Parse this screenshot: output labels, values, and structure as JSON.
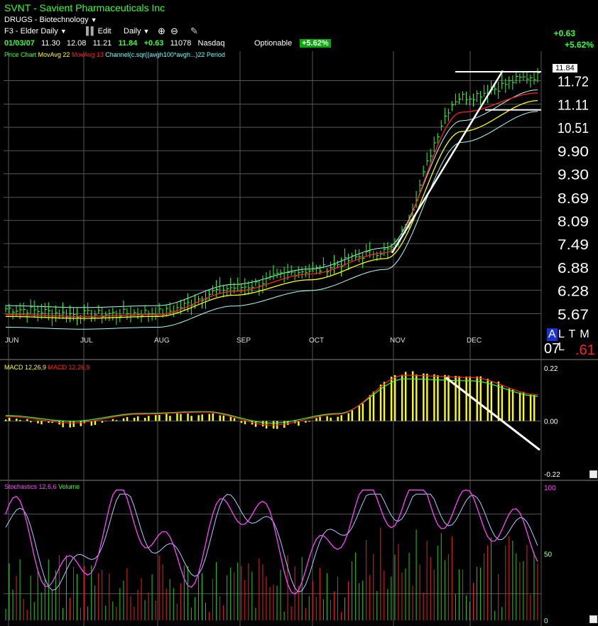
{
  "header": {
    "ticker_line": "SVNT - Savient Pharmaceuticals Inc",
    "group": "DRUGS - Biotechnology",
    "layout": "F3 - Elder Daily",
    "edit_label": "Edit",
    "period": "Daily",
    "date": "01/03/07",
    "open": "11.30",
    "high": "12.08",
    "low": "11.21",
    "close": "11.84",
    "change": "+0.63",
    "volume": "11078",
    "exchange": "Nasdaq",
    "optionable": "Optionable",
    "pct_badge": "+5.62%",
    "right_change": "+0.63",
    "right_pct": "+5.62%"
  },
  "legend": {
    "price": "Price Chart",
    "ma22": "MovAvg 22",
    "ma13": "MovAvg 13",
    "channel": "Channel(c.sqr((avgh100*avgh...)22 Period",
    "macd_a": "MACD 12,26,9",
    "macd_b": "MACD 12,26,9",
    "stoch": "Stochastics 12,6,6",
    "volume": "Volume"
  },
  "price_badge": "11.84",
  "price_badge_behind": "11.72",
  "status": {
    "a": "A",
    "ltml": "L T M L",
    "year": "07",
    "value": ".61"
  },
  "colors": {
    "price": "#33ff33",
    "ma22": "#ffff00",
    "ma13": "#ff2222",
    "channel": "#aaffff",
    "macd_hist": "#ffff00",
    "stoch_k": "#ff44ff",
    "stoch_d": "#aaccff",
    "trendline": "#ffffff"
  },
  "chart_data": [
    {
      "type": "line",
      "panel": "price",
      "y_ticks": [
        "5.67",
        "6.28",
        "6.88",
        "7.49",
        "8.09",
        "8.69",
        "9.30",
        "9.90",
        "10.51",
        "11.11",
        "11.72"
      ],
      "ylim": [
        5.2,
        12.3
      ],
      "x_months": [
        "JUN",
        "JUL",
        "AUG",
        "SEP",
        "OCT",
        "NOV",
        "DEC"
      ],
      "close_by_month": [
        5.8,
        5.65,
        5.7,
        6.35,
        6.8,
        7.3,
        11.3,
        11.84
      ],
      "series": [
        {
          "name": "MovAvg 22",
          "values": [
            5.6,
            5.55,
            5.6,
            6.15,
            6.55,
            7.1,
            10.4,
            11.2
          ]
        },
        {
          "name": "MovAvg 13",
          "values": [
            5.65,
            5.6,
            5.65,
            6.25,
            6.7,
            7.25,
            10.9,
            11.4
          ]
        }
      ]
    },
    {
      "type": "bar",
      "panel": "macd",
      "y_ticks": [
        "0.22",
        "0.00",
        "-0.22"
      ],
      "ylim": [
        -0.22,
        0.22
      ],
      "series": [
        {
          "name": "MACD 12,26,9",
          "values": [
            0.01,
            -0.02,
            0.02,
            0.03,
            -0.03,
            0.02,
            0.2,
            0.19,
            0.11
          ]
        }
      ]
    },
    {
      "type": "line",
      "panel": "stochastics",
      "y_ticks": [
        "100",
        "50",
        "0"
      ],
      "ylim": [
        0,
        100
      ],
      "series": [
        {
          "name": "Stochastics 12,6,6",
          "values": [
            80,
            30,
            85,
            40,
            90,
            35,
            85,
            90,
            80,
            60
          ]
        }
      ]
    }
  ]
}
